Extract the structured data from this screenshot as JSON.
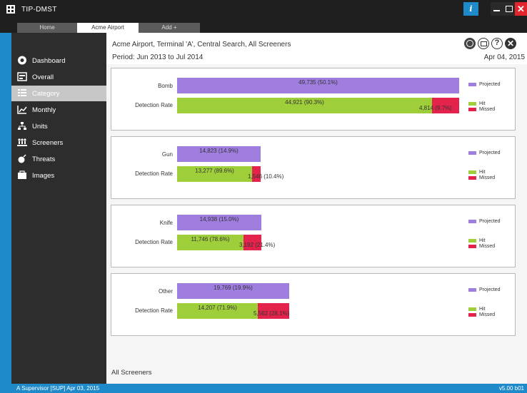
{
  "app": {
    "title": "TIP-DMST"
  },
  "tabs": [
    {
      "label": "Home"
    },
    {
      "label": "Acme Airport"
    },
    {
      "label": "Add +"
    }
  ],
  "sidebar": {
    "items": [
      {
        "label": "Dashboard",
        "icon": "dashboard-icon"
      },
      {
        "label": "Overall",
        "icon": "overall-icon"
      },
      {
        "label": "Category",
        "icon": "category-icon",
        "active": true
      },
      {
        "label": "Monthly",
        "icon": "monthly-icon"
      },
      {
        "label": "Units",
        "icon": "units-icon"
      },
      {
        "label": "Screeners",
        "icon": "screeners-icon"
      },
      {
        "label": "Threats",
        "icon": "threats-icon"
      },
      {
        "label": "Images",
        "icon": "images-icon"
      }
    ]
  },
  "header": {
    "title": "Acme Airport, Terminal 'A', Central Search, All Screeners",
    "period": "Period: Jun 2013 to Jul 2014",
    "date": "Apr 04, 2015"
  },
  "legend": {
    "projected": "Projected",
    "hit": "Hit",
    "missed": "Missed"
  },
  "colors": {
    "projected": "#9f7ee0",
    "hit": "#9fce3b",
    "missed": "#e4234c",
    "accent": "#1f8ac9"
  },
  "categories": [
    {
      "name": "Bomb",
      "projected_label": "49,735 (50.1%)",
      "projected_pct": 50.1,
      "detection_label": "Detection Rate",
      "hit_label": "44,921 (90.3%)",
      "hit_pct": 90.3,
      "missed_label": "4,814 (9.7%)",
      "missed_pct": 9.7
    },
    {
      "name": "Gun",
      "projected_label": "14,823 (14.9%)",
      "projected_pct": 14.9,
      "detection_label": "Detection Rate",
      "hit_label": "13,277 (89.6%)",
      "hit_pct": 89.6,
      "missed_label": "1,546 (10.4%)",
      "missed_pct": 10.4
    },
    {
      "name": "Knife",
      "projected_label": "14,938 (15.0%)",
      "projected_pct": 15.0,
      "detection_label": "Detection Rate",
      "hit_label": "11,746 (78.6%)",
      "hit_pct": 78.6,
      "missed_label": "3,192 (21.4%)",
      "missed_pct": 21.4
    },
    {
      "name": "Other",
      "projected_label": "19,769 (19.9%)",
      "projected_pct": 19.9,
      "detection_label": "Detection Rate",
      "hit_label": "14,207 (71.9%)",
      "hit_pct": 71.9,
      "missed_label": "5,562 (28.1%)",
      "missed_pct": 28.1
    }
  ],
  "footer": {
    "label": "All Screeners"
  },
  "status": {
    "left": "A Supervisor [SUP] Apr 03, 2015",
    "right": "v5.00 b01"
  }
}
